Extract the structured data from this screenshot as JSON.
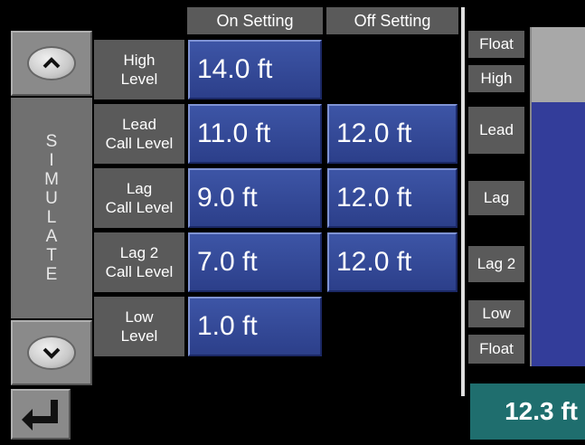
{
  "headers": {
    "on": "On Setting",
    "off": "Off Setting"
  },
  "simulate": {
    "letters": [
      "S",
      "I",
      "M",
      "U",
      "L",
      "A",
      "T",
      "E"
    ]
  },
  "rows": [
    {
      "label_line1": "High",
      "label_line2": "Level",
      "on": "14.0 ft",
      "off": ""
    },
    {
      "label_line1": "Lead",
      "label_line2": "Call Level",
      "on": "11.0 ft",
      "off": "12.0 ft"
    },
    {
      "label_line1": "Lag",
      "label_line2": "Call Level",
      "on": "9.0 ft",
      "off": "12.0 ft"
    },
    {
      "label_line1": "Lag 2",
      "label_line2": "Call Level",
      "on": "7.0 ft",
      "off": "12.0 ft"
    },
    {
      "label_line1": "Low",
      "label_line2": "Level",
      "on": "1.0 ft",
      "off": ""
    }
  ],
  "gauge": {
    "labels": {
      "float_top": "Float",
      "high": "High",
      "lead": "Lead",
      "lag": "Lag",
      "lag2": "Lag 2",
      "low": "Low",
      "float_bottom": "Float"
    },
    "level_fraction": 0.78,
    "fill_color": "#333d9a",
    "empty_color": "#a8a8a8",
    "readout": "12.3 ft"
  },
  "icons": {
    "up": "chevron-up-icon",
    "down": "chevron-down-icon",
    "enter": "enter-return-icon"
  }
}
